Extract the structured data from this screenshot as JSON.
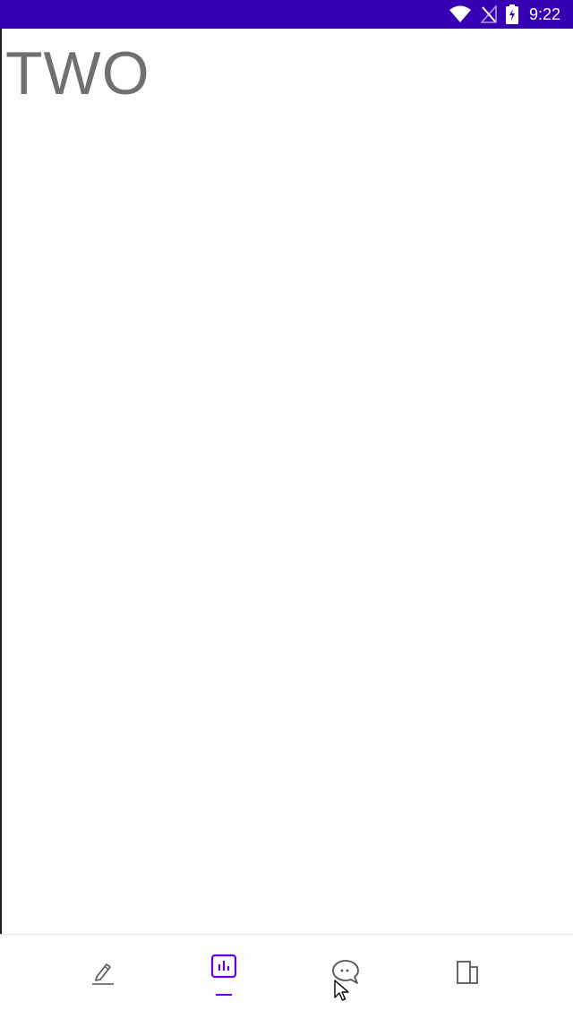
{
  "status_bar": {
    "time": "9:22",
    "background_color": "#3700b3",
    "icons": [
      "wifi-icon",
      "signal-off-icon",
      "battery-charging-icon"
    ]
  },
  "main": {
    "title": "TWO"
  },
  "bottom_nav": {
    "active_color": "#6200ee",
    "inactive_color": "#555555",
    "items": [
      {
        "icon": "pencil-icon",
        "active": false
      },
      {
        "icon": "bar-chart-icon",
        "active": true
      },
      {
        "icon": "chat-bubble-icon",
        "active": false
      },
      {
        "icon": "book-icon",
        "active": false
      }
    ]
  }
}
